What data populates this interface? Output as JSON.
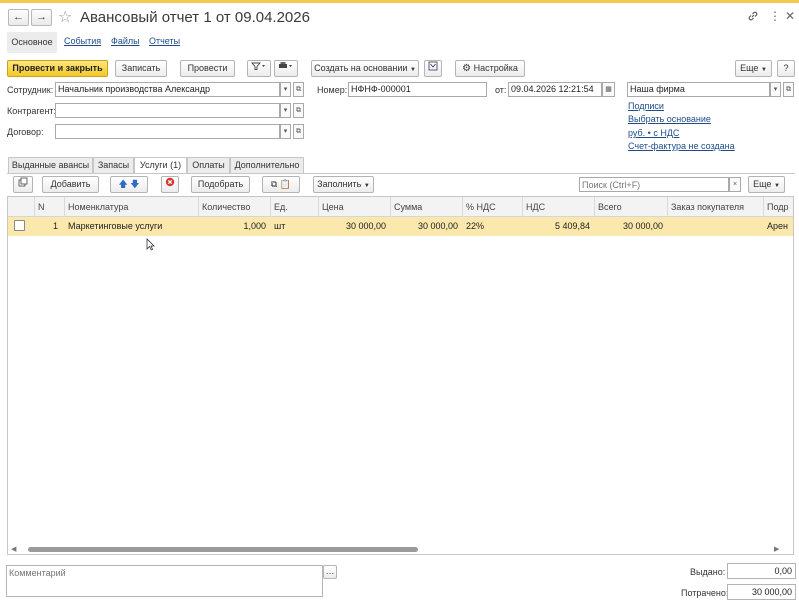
{
  "window": {
    "title": "Авансовый отчет 1 от 09.04.2026",
    "back_glyph": "←",
    "forward_glyph": "→",
    "star_glyph": "☆",
    "link_glyph": "🔗",
    "more_glyph": "⋮",
    "close_glyph": "✕"
  },
  "nav_tabs": [
    {
      "label": "Основное"
    },
    {
      "label": "События"
    },
    {
      "label": "Файлы"
    },
    {
      "label": "Отчеты"
    }
  ],
  "toolbar": {
    "post_and_close": "Провести и закрыть",
    "save": "Записать",
    "post": "Провести",
    "create_based_on": "Создать на основании",
    "settings": "Настройка",
    "more": "Еще",
    "help": "?"
  },
  "form": {
    "employee_label": "Сотрудник:",
    "employee_value": "Начальник производства Александр",
    "counterparty_label": "Контрагент:",
    "counterparty_value": "",
    "contract_label": "Договор:",
    "contract_value": "",
    "number_label": "Номер:",
    "number_value": "НФНФ-000001",
    "date_label": "от:",
    "date_value": "09.04.2026 12:21:54",
    "organization_value": "Наша фирма"
  },
  "side_links": [
    {
      "label": "Подписи"
    },
    {
      "label": "Выбрать основание"
    },
    {
      "label": "руб. • с НДС"
    },
    {
      "label": "Счет-фактура не создана"
    }
  ],
  "doc_tabs": [
    {
      "label": "Выданные авансы"
    },
    {
      "label": "Запасы"
    },
    {
      "label": "Услуги (1)"
    },
    {
      "label": "Оплаты"
    },
    {
      "label": "Дополнительно"
    }
  ],
  "table_toolbar": {
    "add": "Добавить",
    "select": "Подобрать",
    "fill": "Заполнить",
    "search_placeholder": "Поиск (Ctrl+F)",
    "more": "Еще"
  },
  "table": {
    "columns": [
      "N",
      "Номенклатура",
      "Количество",
      "Ед.",
      "Цена",
      "Сумма",
      "% НДС",
      "НДС",
      "Всего",
      "Заказ покупателя",
      "Подр"
    ],
    "rows": [
      {
        "n": "1",
        "item": "Маркетинговые услуги",
        "qty": "1,000",
        "unit": "шт",
        "price": "30 000,00",
        "amount": "30 000,00",
        "vat_rate": "22%",
        "vat": "5 409,84",
        "total": "30 000,00",
        "order": "",
        "dept": "Арен"
      }
    ]
  },
  "footer": {
    "comment_placeholder": "Комментарий",
    "issued_label": "Выдано:",
    "issued_value": "0,00",
    "spent_label": "Потрачено:",
    "spent_value": "30 000,00"
  }
}
